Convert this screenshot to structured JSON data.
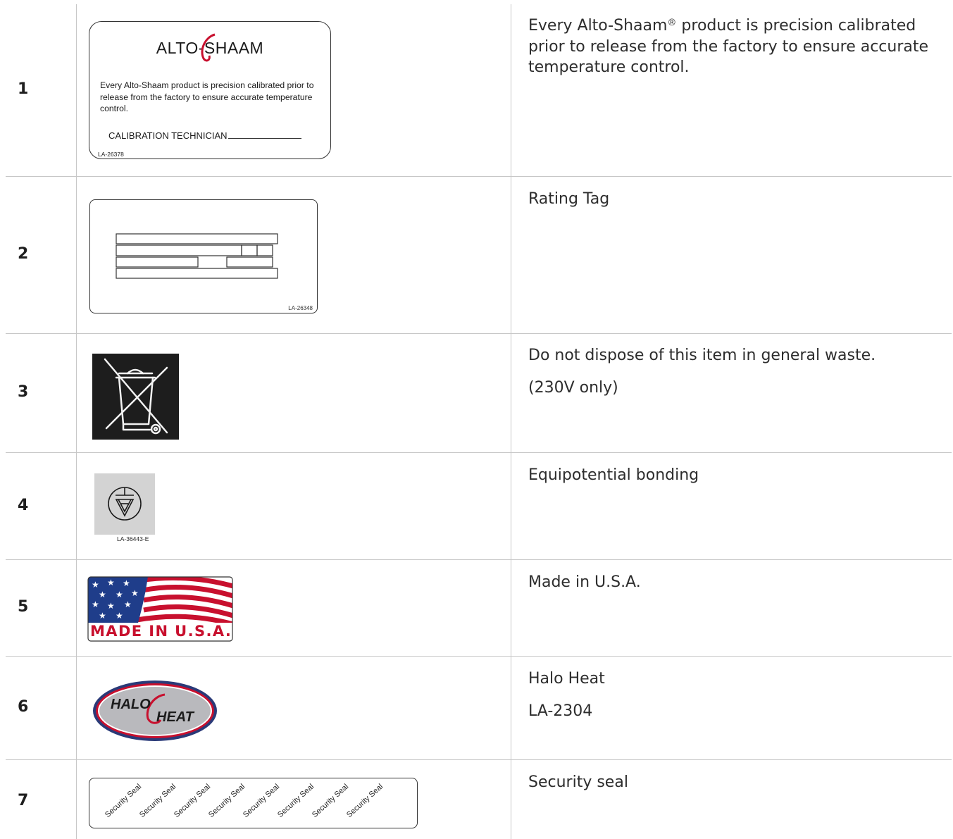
{
  "rows": [
    {
      "number": "1",
      "label_image": {
        "brand": "ALTO-SHAAM",
        "text": "Every Alto-Shaam product is precision calibrated prior to release from the factory to ensure accurate temperature control.",
        "technician_label": "CALIBRATION TECHNICIAN",
        "code": "LA-26378"
      },
      "description": {
        "part1": "Every Alto-Shaam",
        "registered": "®",
        "part2": " product is precision calibrated prior to release from the factory to ensure accurate temperature control."
      }
    },
    {
      "number": "2",
      "label_image": {
        "code": "LA-26348"
      },
      "description": {
        "line1": "Rating Tag"
      }
    },
    {
      "number": "3",
      "label_image": {
        "icon": "crossed-out-wheelie-bin-icon"
      },
      "description": {
        "line1": "Do not dispose of this item in general waste.",
        "line2": "(230V only)"
      }
    },
    {
      "number": "4",
      "label_image": {
        "icon": "equipotential-bonding-icon",
        "code": "LA-36443-E"
      },
      "description": {
        "line1": "Equipotential bonding"
      }
    },
    {
      "number": "5",
      "label_image": {
        "text": "MADE IN U.S.A.",
        "icon": "us-flag-icon"
      },
      "description": {
        "line1": "Made in U.S.A."
      }
    },
    {
      "number": "6",
      "label_image": {
        "text_left": "HALO",
        "text_right": "HEAT"
      },
      "description": {
        "line1": "Halo Heat",
        "line2": "LA-2304"
      }
    },
    {
      "number": "7",
      "label_image": {
        "repeated_text": "Security Seal"
      },
      "description": {
        "line1": "Security seal"
      }
    }
  ],
  "colors": {
    "grid": "#c7c7c7",
    "text": "#2d2d2d",
    "brand_red": "#c8102e",
    "flag_blue": "#1f3d8a",
    "halo_blue": "#2a3a78",
    "halo_red": "#c8102e"
  }
}
